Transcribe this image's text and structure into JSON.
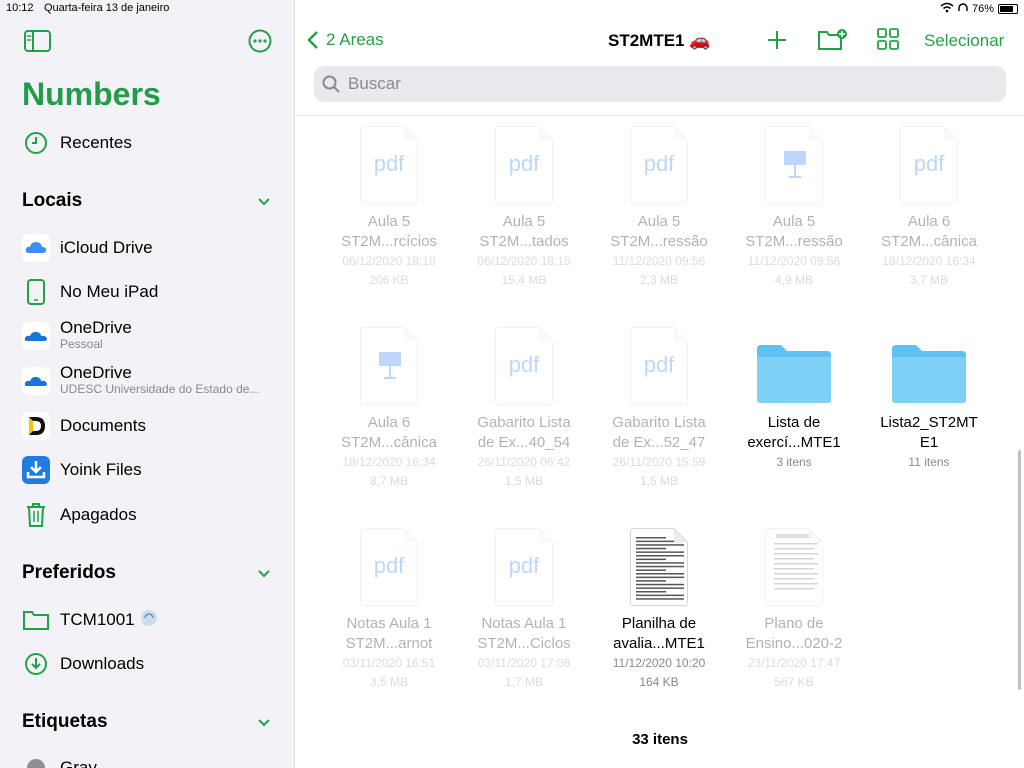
{
  "status_bar": {
    "time": "10:12",
    "date": "Quarta-feira 13 de janeiro",
    "battery": "76%"
  },
  "sidebar": {
    "app_title": "Numbers",
    "recents_label": "Recentes",
    "sections": {
      "locais": "Locais",
      "preferidos": "Preferidos",
      "etiquetas": "Etiquetas"
    },
    "locais": [
      {
        "label": "iCloud Drive",
        "icon": "icloud-icon"
      },
      {
        "label": "No Meu iPad",
        "icon": "ipad-icon"
      },
      {
        "label": "OneDrive",
        "sub": "Pessoal",
        "icon": "onedrive-icon"
      },
      {
        "label": "OneDrive",
        "sub": "UDESC Universidade do Estado de...",
        "icon": "onedrive-icon"
      },
      {
        "label": "Documents",
        "icon": "documents-icon"
      },
      {
        "label": "Yoink Files",
        "icon": "yoink-icon"
      },
      {
        "label": "Apagados",
        "icon": "trash-icon"
      }
    ],
    "preferidos": [
      {
        "label": "TCM1001",
        "icon": "folder-icon"
      },
      {
        "label": "Downloads",
        "icon": "download-icon"
      }
    ],
    "etiquetas": [
      {
        "label": "Gray"
      }
    ]
  },
  "toolbar": {
    "back_label": "2 Areas",
    "title": "ST2MTE1 🚗",
    "select_label": "Selecionar",
    "search_placeholder": "Buscar"
  },
  "files": [
    {
      "name1": "Aula 5",
      "name2": "ST2M...rcícios",
      "date": "06/12/2020 18:18",
      "size": "206 KB",
      "kind": "pdf",
      "dim": true
    },
    {
      "name1": "Aula 5",
      "name2": "ST2M...tados",
      "date": "06/12/2020 18:15",
      "size": "15,4 MB",
      "kind": "pdf",
      "dim": true
    },
    {
      "name1": "Aula 5",
      "name2": "ST2M...ressão",
      "date": "11/12/2020 09:56",
      "size": "2,3 MB",
      "kind": "pdf",
      "dim": true
    },
    {
      "name1": "Aula 5",
      "name2": "ST2M...ressão",
      "date": "11/12/2020 09:56",
      "size": "4,9 MB",
      "kind": "keynote",
      "dim": true
    },
    {
      "name1": "Aula 6",
      "name2": "ST2M...cânica",
      "date": "18/12/2020 16:34",
      "size": "3,7 MB",
      "kind": "pdf",
      "dim": true
    },
    {
      "name1": "Aula 6",
      "name2": "ST2M...cânica",
      "date": "18/12/2020 16:34",
      "size": "8,7 MB",
      "kind": "keynote",
      "dim": true
    },
    {
      "name1": "Gabarito Lista",
      "name2": "de Ex...40_54",
      "date": "26/11/2020 06:42",
      "size": "1,5 MB",
      "kind": "pdf",
      "dim": true
    },
    {
      "name1": "Gabarito Lista",
      "name2": "de Ex...52_47",
      "date": "26/11/2020 15:59",
      "size": "1,5 MB",
      "kind": "pdf",
      "dim": true
    },
    {
      "name1": "Lista de",
      "name2": "exercí...MTE1",
      "date": "3 itens",
      "size": "",
      "kind": "folder",
      "dim": false
    },
    {
      "name1": "Lista2_ST2MT",
      "name2": "E1",
      "date": "11 itens",
      "size": "",
      "kind": "folder",
      "dim": false
    },
    {
      "name1": "Notas Aula 1",
      "name2": "ST2M...arnot",
      "date": "03/11/2020 16:51",
      "size": "3,5 MB",
      "kind": "pdf",
      "dim": true
    },
    {
      "name1": "Notas Aula 1",
      "name2": "ST2M...Ciclos",
      "date": "03/11/2020 17:08",
      "size": "1,7 MB",
      "kind": "pdf",
      "dim": true
    },
    {
      "name1": "Planilha de",
      "name2": "avalia...MTE1",
      "date": "11/12/2020 10:20",
      "size": "164 KB",
      "kind": "sheet",
      "dim": false
    },
    {
      "name1": "Plano de",
      "name2": "Ensino...020-2",
      "date": "23/11/2020 17:47",
      "size": "567 KB",
      "kind": "docthumb",
      "dim": true
    }
  ],
  "pdf_label": "pdf",
  "item_count": "33 itens",
  "colors": {
    "accent": "#24a148",
    "folder": "#5fc1f2",
    "pdf": "#2b7bf0"
  }
}
